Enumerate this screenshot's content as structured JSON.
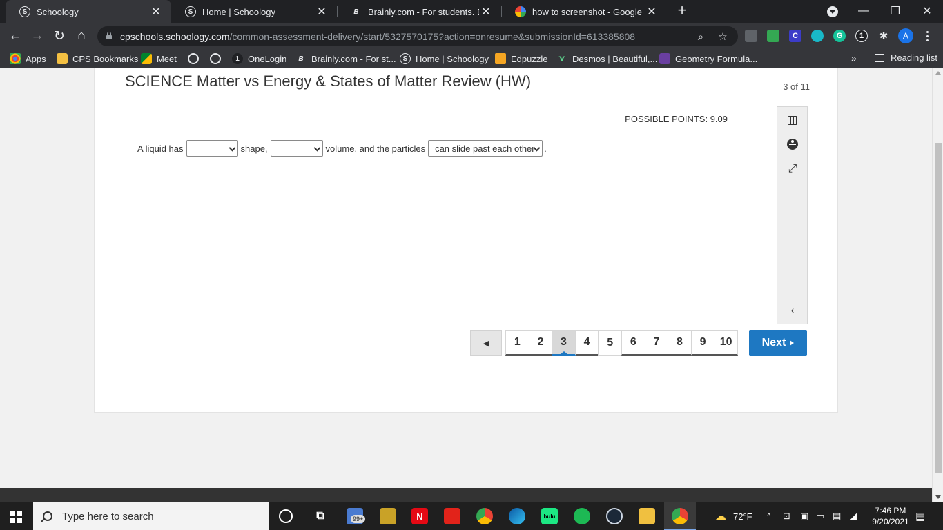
{
  "browser": {
    "tabs": [
      {
        "title": "Schoology",
        "favicon": "S",
        "active": true
      },
      {
        "title": "Home | Schoology",
        "favicon": "S",
        "active": false
      },
      {
        "title": "Brainly.com - For students. By stu",
        "favicon": "B",
        "active": false
      },
      {
        "title": "how to screenshot - Google Sear",
        "favicon": "G",
        "active": false
      }
    ],
    "url_host": "cpschools.schoology.com",
    "url_path": "/common-assessment-delivery/start/5327570175?action=onresume&submissionId=613385808",
    "bookmarks": [
      {
        "label": "Apps",
        "icon": "apps-grid-icon"
      },
      {
        "label": "CPS Bookmarks",
        "icon": "folder-icon"
      },
      {
        "label": "Meet",
        "icon": "meet-icon"
      },
      {
        "label": "",
        "icon": "globe-icon"
      },
      {
        "label": "",
        "icon": "globe-icon"
      },
      {
        "label": "OneLogin",
        "icon": "onelogin-icon"
      },
      {
        "label": "Brainly.com - For st...",
        "icon": "brainly-icon"
      },
      {
        "label": "Home | Schoology",
        "icon": "schoology-icon"
      },
      {
        "label": "Edpuzzle",
        "icon": "edpuzzle-icon"
      },
      {
        "label": "Desmos | Beautiful,...",
        "icon": "desmos-icon"
      },
      {
        "label": "Geometry Formula...",
        "icon": "geometry-icon"
      }
    ],
    "bookmarks_more": "»",
    "reading_list": "Reading list",
    "profile_initial": "A"
  },
  "assessment": {
    "title": "SCIENCE Matter vs Energy & States of Matter Review (HW)",
    "progress": "3 of 11",
    "points": "POSSIBLE POINTS: 9.09",
    "question": {
      "part1": "A liquid has",
      "part2": "shape,",
      "part3": "volume, and the particles",
      "part4": ".",
      "select1": "",
      "select2": "",
      "select3": "can slide past each other"
    },
    "pager": {
      "pages": [
        "1",
        "2",
        "3",
        "4",
        "5",
        "6",
        "7",
        "8",
        "9",
        "10"
      ],
      "current": "3",
      "next_label": "Next"
    }
  },
  "taskbar": {
    "search_placeholder": "Type here to search",
    "mail_badge": "99+",
    "weather": "72°F",
    "time": "7:46 PM",
    "date": "9/20/2021"
  },
  "colors": {
    "accent": "#1e78c2",
    "chrome_dark": "#202124",
    "chrome_toolbar": "#35363a"
  }
}
